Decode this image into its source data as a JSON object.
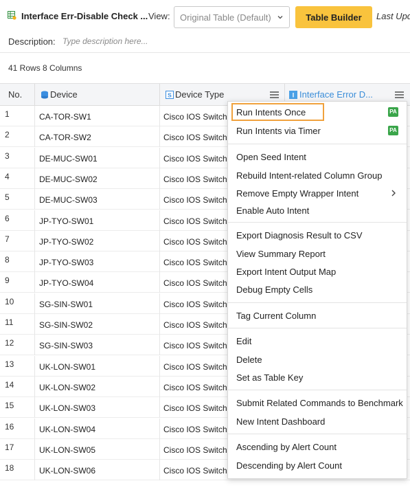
{
  "toolbar": {
    "title": "Interface Err-Disable Check ...",
    "view_label": "View:",
    "view_value": "Original Table (Default)",
    "table_builder": "Table Builder",
    "last_update": "Last Upda",
    "accent_color": "#f9c33d"
  },
  "description": {
    "label": "Description:",
    "placeholder": "Type description here..."
  },
  "summary": {
    "text": "41 Rows  8 Columns"
  },
  "table": {
    "headers": {
      "no": "No.",
      "device": "Device",
      "device_type": "Device Type",
      "interface_error": "Interface Error D..."
    },
    "rows": [
      {
        "no": "1",
        "device": "CA-TOR-SW1",
        "type": "Cisco IOS Switch"
      },
      {
        "no": "2",
        "device": "CA-TOR-SW2",
        "type": "Cisco IOS Switch"
      },
      {
        "no": "3",
        "device": "DE-MUC-SW01",
        "type": "Cisco IOS Switch"
      },
      {
        "no": "4",
        "device": "DE-MUC-SW02",
        "type": "Cisco IOS Switch"
      },
      {
        "no": "5",
        "device": "DE-MUC-SW03",
        "type": "Cisco IOS Switch"
      },
      {
        "no": "6",
        "device": "JP-TYO-SW01",
        "type": "Cisco IOS Switch"
      },
      {
        "no": "7",
        "device": "JP-TYO-SW02",
        "type": "Cisco IOS Switch"
      },
      {
        "no": "8",
        "device": "JP-TYO-SW03",
        "type": "Cisco IOS Switch"
      },
      {
        "no": "9",
        "device": "JP-TYO-SW04",
        "type": "Cisco IOS Switch"
      },
      {
        "no": "10",
        "device": "SG-SIN-SW01",
        "type": "Cisco IOS Switch"
      },
      {
        "no": "11",
        "device": "SG-SIN-SW02",
        "type": "Cisco IOS Switch"
      },
      {
        "no": "12",
        "device": "SG-SIN-SW03",
        "type": "Cisco IOS Switch"
      },
      {
        "no": "13",
        "device": "UK-LON-SW01",
        "type": "Cisco IOS Switch"
      },
      {
        "no": "14",
        "device": "UK-LON-SW02",
        "type": "Cisco IOS Switch"
      },
      {
        "no": "15",
        "device": "UK-LON-SW03",
        "type": "Cisco IOS Switch"
      },
      {
        "no": "16",
        "device": "UK-LON-SW04",
        "type": "Cisco IOS Switch"
      },
      {
        "no": "17",
        "device": "UK-LON-SW05",
        "type": "Cisco IOS Switch"
      },
      {
        "no": "18",
        "device": "UK-LON-SW06",
        "type": "Cisco IOS Switch"
      }
    ]
  },
  "context_menu": {
    "items": [
      {
        "label": "Run Intents Once",
        "badge": "PA",
        "highlighted": true
      },
      {
        "label": "Run Intents via Timer",
        "badge": "PA"
      },
      {
        "label": "Open Seed Intent"
      },
      {
        "label": "Rebuild Intent-related Column Group"
      },
      {
        "label": "Remove Empty Wrapper Intent",
        "submenu": true
      },
      {
        "label": "Enable Auto Intent"
      },
      {
        "label": "Export Diagnosis Result to CSV"
      },
      {
        "label": "View Summary Report"
      },
      {
        "label": "Export Intent Output Map"
      },
      {
        "label": "Debug Empty Cells"
      },
      {
        "label": "Tag Current Column"
      },
      {
        "label": "Edit"
      },
      {
        "label": "Delete"
      },
      {
        "label": "Set as Table Key"
      },
      {
        "label": "Submit Related Commands to Benchmark"
      },
      {
        "label": "New Intent Dashboard"
      },
      {
        "label": "Ascending by Alert Count"
      },
      {
        "label": "Descending by Alert Count"
      }
    ]
  }
}
